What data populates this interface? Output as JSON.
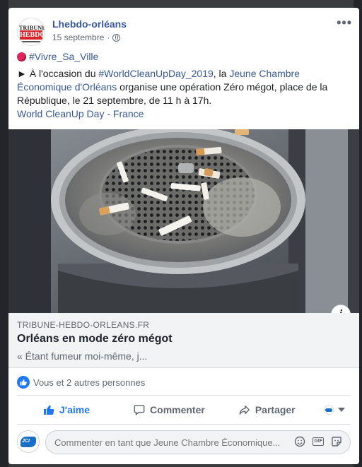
{
  "post": {
    "page_name": "Lhebdo-orléans",
    "date": "15 septembre",
    "separator": "·",
    "more_label": "•••",
    "avatar_logo": {
      "line1": "TRIBUNE",
      "line2": "HEBDO"
    },
    "hashtag_vivre": "#Vivre_Sa_Ville",
    "text_arrow": "► À l'occasion du ",
    "hashtag_wcud": "#WorldCleanUpDay_2019",
    "text_la": ", la ",
    "mention_jce": "Jeune Chambre Économique d'Orléans",
    "text_rest": " organise une opération Zéro mégot, place de la République, le 21 septembre, de 11 h à 17h.",
    "page_link": "World CleanUp Day - France"
  },
  "link_preview": {
    "domain": "TRIBUNE-HEBDO-ORLEANS.FR",
    "title": "Orléans en mode zéro mégot",
    "description": "« Étant fumeur moi-même, j...",
    "info_icon": "i"
  },
  "reactions": {
    "text": "Vous et 2 autres personnes"
  },
  "actions": {
    "like_label": "J'aime",
    "comment_label": "Commenter",
    "share_label": "Partager"
  },
  "comment_box": {
    "placeholder": "Commenter en tant que Jeune Chambre Économique...",
    "avatar_text": "JCI",
    "gif_label": "GIF"
  },
  "colors": {
    "link": "#385898",
    "like_blue": "#2078f4",
    "muted": "#606770"
  }
}
